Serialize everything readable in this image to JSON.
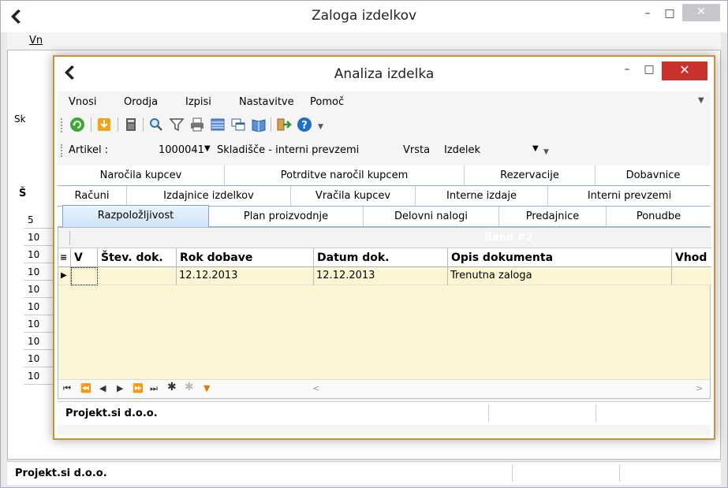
{
  "outer": {
    "title": "Zaloga izdelkov",
    "menu_fragment": "Vn",
    "filter_fragment": "Sk",
    "grid_col_fragment": "Š",
    "row_labels": [
      "5",
      "10",
      "10",
      "10",
      "10",
      "10",
      "10",
      "10",
      "10",
      "10"
    ],
    "status": "Projekt.si d.o.o."
  },
  "inner": {
    "title": "Analiza izdelka",
    "menu": [
      {
        "label": "Vnosi"
      },
      {
        "label": "Orodja"
      },
      {
        "label": "Izpisi"
      },
      {
        "label": "Nastavitve"
      },
      {
        "label": "Pomoč"
      }
    ],
    "toolbar_icons": [
      "refresh-icon",
      "download-icon",
      "calculator-icon",
      "search-icon",
      "filter-icon",
      "print-icon",
      "grid-view-icon",
      "windows-icon",
      "book-icon",
      "exit-icon",
      "help-icon"
    ],
    "filter": {
      "artikel_label": "Artikel :",
      "artikel_value": "1000041",
      "skladisce_label": "Skladišče - interni prevzemi",
      "vrsta_label": "Vrsta",
      "vrsta_value": "Izdelek"
    },
    "tabs_row1": [
      "Naročila kupcev",
      "Potrditve naročil kupcem",
      "Rezervacije",
      "Dobavnice"
    ],
    "tabs_row2": [
      "Računi",
      "Izdajnice izdelkov",
      "Vračila kupcev",
      "Interne izdaje",
      "Interni prevzemi"
    ],
    "tabs_row3": [
      "Razpoložljivost",
      "Plan proizvodnje",
      "Delovni nalogi",
      "Predajnice",
      "Ponudbe"
    ],
    "active_tab": "Razpoložljivost",
    "band_label": "Band #2",
    "columns": [
      "V",
      "Štev. dok.",
      "Rok dobave",
      "Datum dok.",
      "Opis dokumenta",
      "Vhod"
    ],
    "rows": [
      {
        "v": "",
        "stev_dok": "",
        "rok_dobave": "12.12.2013",
        "datum_dok": "12.12.2013",
        "opis": "Trenutna zaloga",
        "vhod": ""
      }
    ],
    "status": "Projekt.si d.o.o."
  },
  "colors": {
    "inner_border": "#c8923a",
    "close_red": "#c9312c",
    "grid_bg": "#fdf6d4",
    "tab_active": "#cfe3f8"
  }
}
